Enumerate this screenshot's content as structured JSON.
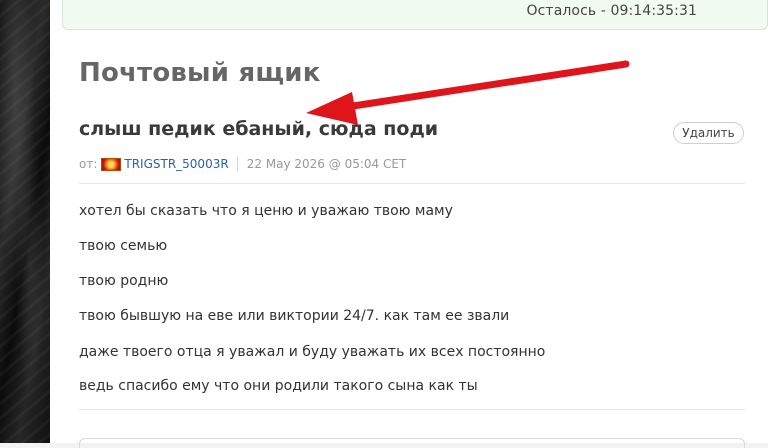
{
  "timer": {
    "text": "Осталось - 09:14:35:31"
  },
  "page": {
    "title": "Почтовый ящик"
  },
  "message": {
    "subject": "слыш педик ебаный, сюда поди",
    "delete_label": "Удалить",
    "from_label": "от:",
    "sender": "TRIGSTR_50003R",
    "date": "22 May 2026 @ 05:04 CET",
    "body": [
      "хотел бы сказать что я ценю и уважаю твою маму",
      "твою семью",
      "твою родню",
      "твою бывшую на еве или виктории 24/7. как там ее звали",
      "даже твоего отца я уважал и буду уважать их всех постоянно",
      "ведь спасибо ему что они родили такого сына как ты"
    ]
  },
  "annotation": {
    "arrow_color": "#e0141b"
  },
  "icons": {
    "sender_flag": "flag-icon"
  }
}
